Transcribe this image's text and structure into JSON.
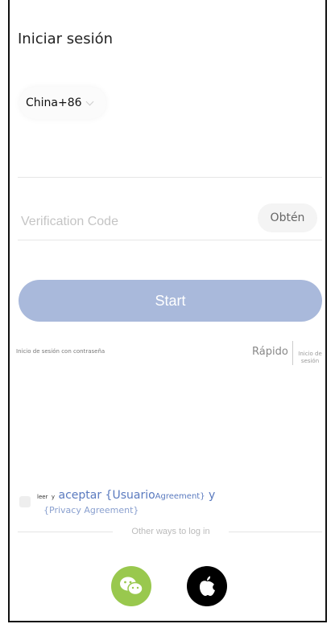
{
  "header": {
    "title": "Iniciar sesión"
  },
  "country": {
    "label": "China+86"
  },
  "phone": {
    "value": ""
  },
  "code": {
    "placeholder": "Verification Code"
  },
  "buttons": {
    "obtain": "Obtén",
    "start": "Start"
  },
  "login_modes": {
    "password": "Inicio de sesión con contraseña",
    "quick": "Rápido",
    "quick_sub": "Inicio de sesión"
  },
  "agreement": {
    "read": "leer",
    "and_small": "y",
    "accept": "aceptar {Usuario",
    "agreement_suffix": "Agreement}",
    "and": "y",
    "privacy": "{Privacy Agreement}"
  },
  "social": {
    "other_ways": "Other ways to log in",
    "wechat_icon": "wechat-icon",
    "apple_icon": "apple-icon"
  },
  "colors": {
    "start_bg": "#a9b9db",
    "link": "#5a7abf",
    "wechat": "#99c84e"
  }
}
